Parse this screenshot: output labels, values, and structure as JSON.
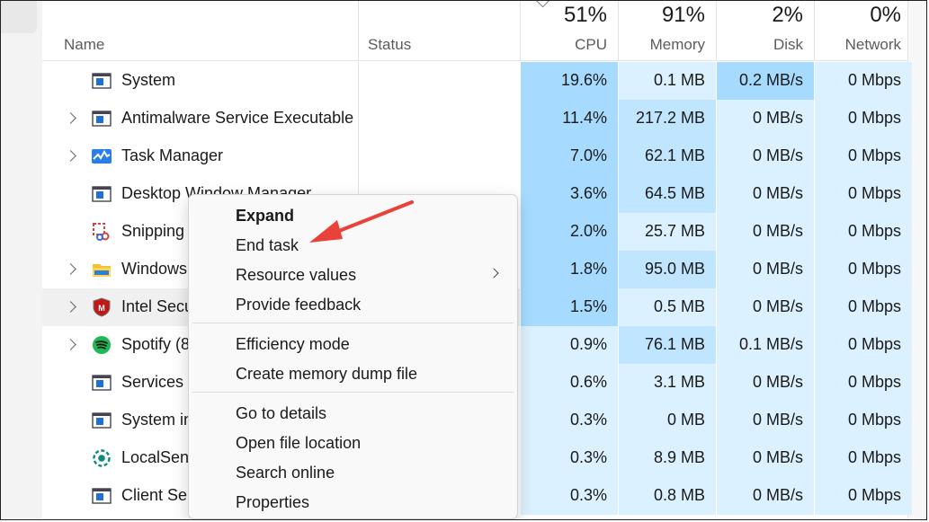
{
  "header": {
    "name": "Name",
    "status": "Status",
    "cpu": {
      "pct": "51%",
      "label": "CPU"
    },
    "memory": {
      "pct": "91%",
      "label": "Memory"
    },
    "disk": {
      "pct": "2%",
      "label": "Disk"
    },
    "network": {
      "pct": "0%",
      "label": "Network"
    }
  },
  "processes": [
    {
      "name": "System",
      "expandable": false,
      "icon": "system-window-icon",
      "cpu": "19.6%",
      "memory": "0.1 MB",
      "disk": "0.2 MB/s",
      "network": "0 Mbps"
    },
    {
      "name": "Antimalware Service Executable",
      "expandable": true,
      "icon": "system-window-icon",
      "cpu": "11.4%",
      "memory": "217.2 MB",
      "disk": "0 MB/s",
      "network": "0 Mbps"
    },
    {
      "name": "Task Manager",
      "expandable": true,
      "icon": "task-manager-icon",
      "cpu": "7.0%",
      "memory": "62.1 MB",
      "disk": "0 MB/s",
      "network": "0 Mbps"
    },
    {
      "name": "Desktop Window Manager",
      "expandable": false,
      "icon": "system-window-icon",
      "cpu": "3.6%",
      "memory": "64.5 MB",
      "disk": "0 MB/s",
      "network": "0 Mbps"
    },
    {
      "name": "Snipping",
      "expandable": false,
      "icon": "snipping-tool-icon",
      "cpu": "2.0%",
      "memory": "25.7 MB",
      "disk": "0 MB/s",
      "network": "0 Mbps"
    },
    {
      "name": "Windows",
      "expandable": true,
      "icon": "folder-icon",
      "cpu": "1.8%",
      "memory": "95.0 MB",
      "disk": "0 MB/s",
      "network": "0 Mbps"
    },
    {
      "name": "Intel Secu",
      "expandable": true,
      "icon": "mcafee-shield-icon",
      "cpu": "1.5%",
      "memory": "0.5 MB",
      "disk": "0 MB/s",
      "network": "0 Mbps",
      "highlighted": true
    },
    {
      "name": "Spotify (8",
      "expandable": true,
      "icon": "spotify-icon",
      "cpu": "0.9%",
      "memory": "76.1 MB",
      "disk": "0.1 MB/s",
      "network": "0 Mbps"
    },
    {
      "name": "Services a",
      "expandable": false,
      "icon": "system-window-icon",
      "cpu": "0.6%",
      "memory": "3.1 MB",
      "disk": "0 MB/s",
      "network": "0 Mbps"
    },
    {
      "name": "System in",
      "expandable": false,
      "icon": "system-window-icon",
      "cpu": "0.3%",
      "memory": "0 MB",
      "disk": "0 MB/s",
      "network": "0 Mbps"
    },
    {
      "name": "LocalSend",
      "expandable": false,
      "icon": "localsend-icon",
      "cpu": "0.3%",
      "memory": "8.9 MB",
      "disk": "0 MB/s",
      "network": "0 Mbps"
    },
    {
      "name": "Client Ser",
      "expandable": false,
      "icon": "system-window-icon",
      "cpu": "0.3%",
      "memory": "0.8 MB",
      "disk": "0 MB/s",
      "network": "0 Mbps"
    }
  ],
  "context_menu": {
    "expand": "Expand",
    "end_task": "End task",
    "resource_values": "Resource values",
    "provide_feedback": "Provide feedback",
    "efficiency_mode": "Efficiency mode",
    "create_dump": "Create memory dump file",
    "go_to_details": "Go to details",
    "open_file_location": "Open file location",
    "search_online": "Search online",
    "properties": "Properties"
  },
  "colors": {
    "heat_high": "#a6dbff",
    "heat_mid": "#bfe5ff",
    "heat_low": "#dcf1ff",
    "arrow": "#e8423a"
  }
}
